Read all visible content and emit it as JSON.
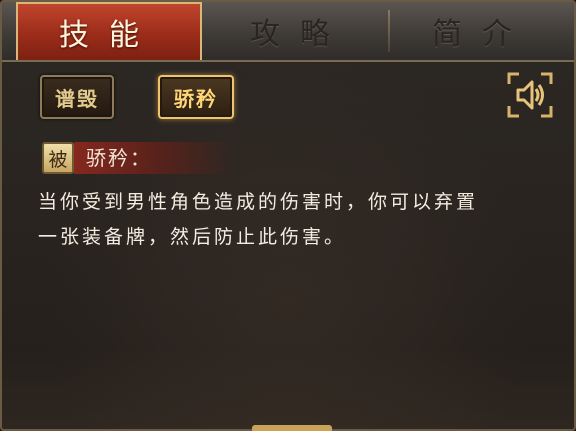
{
  "tabs": [
    {
      "label": "技能",
      "active": true
    },
    {
      "label": "攻略",
      "active": false
    },
    {
      "label": "简介",
      "active": false
    }
  ],
  "skill_buttons": [
    {
      "label": "谱毁",
      "selected": false
    },
    {
      "label": "骄矜",
      "selected": true
    }
  ],
  "audio_button": {
    "icon": "speaker-icon"
  },
  "skill": {
    "badge": "被",
    "title": "骄矜：",
    "description_lines": [
      "当你受到男性角色造成的伤害时，你可以弃置",
      "一张装备牌，然后防止此伤害。"
    ]
  },
  "colors": {
    "active_tab": "#b03a24",
    "gold_border": "#c9a357",
    "text": "#f3ece1"
  }
}
